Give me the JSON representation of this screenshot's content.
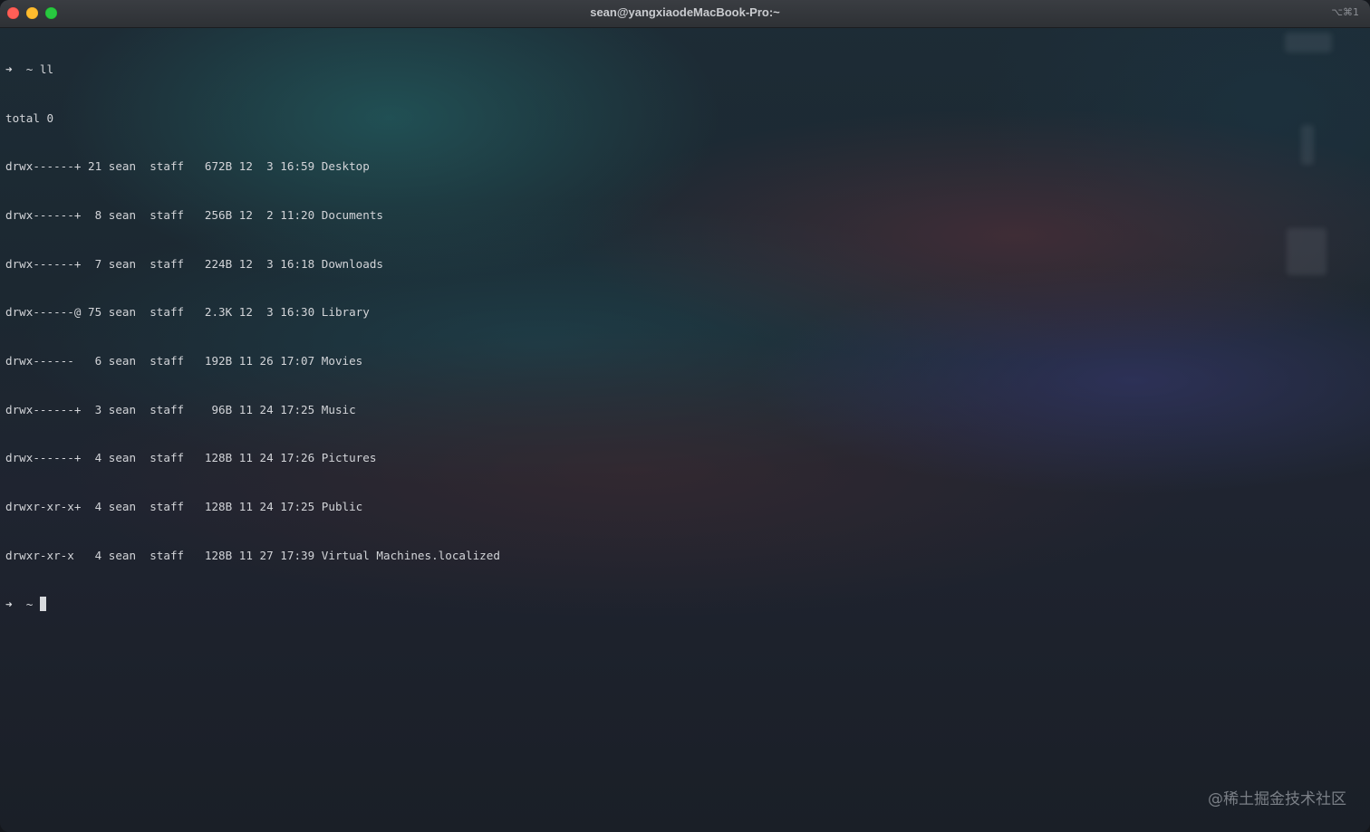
{
  "window": {
    "title": "sean@yangxiaodeMacBook-Pro:~",
    "shortcut": "⌥⌘1"
  },
  "terminal": {
    "command_line": {
      "arrow": "➜",
      "text": "  ~ ll"
    },
    "total": "total 0",
    "listing": [
      "drwx------+ 21 sean  staff   672B 12  3 16:59 Desktop",
      "drwx------+  8 sean  staff   256B 12  2 11:20 Documents",
      "drwx------+  7 sean  staff   224B 12  3 16:18 Downloads",
      "drwx------@ 75 sean  staff   2.3K 12  3 16:30 Library",
      "drwx------   6 sean  staff   192B 11 26 17:07 Movies",
      "drwx------+  3 sean  staff    96B 11 24 17:25 Music",
      "drwx------+  4 sean  staff   128B 11 24 17:26 Pictures",
      "drwxr-xr-x+  4 sean  staff   128B 11 24 17:25 Public",
      "drwxr-xr-x   4 sean  staff   128B 11 27 17:39 Virtual Machines.localized"
    ],
    "current_prompt": {
      "arrow": "➜",
      "text": "  ~ "
    }
  },
  "watermark": "@稀土掘金技术社区",
  "colors": {
    "close": "#ff5f57",
    "minimize": "#febc2e",
    "zoom": "#28c840",
    "text": "#d2d4d8"
  }
}
